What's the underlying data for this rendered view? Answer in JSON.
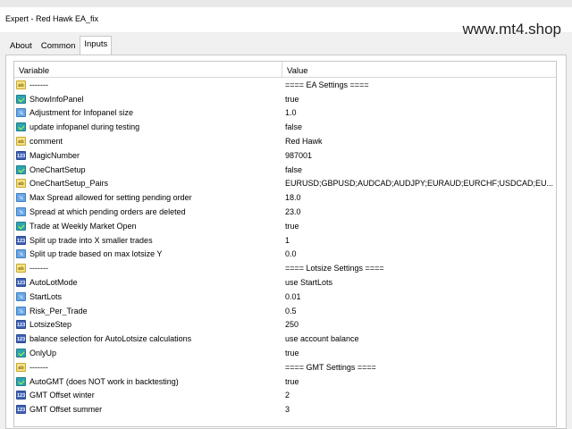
{
  "window": {
    "title": "Expert - Red Hawk EA_fix",
    "watermark": "www.mt4.shop"
  },
  "tabs": [
    {
      "label": "About",
      "active": false
    },
    {
      "label": "Common",
      "active": false
    },
    {
      "label": "Inputs",
      "active": true
    }
  ],
  "table": {
    "headers": [
      "Variable",
      "Value"
    ],
    "rows": [
      {
        "icon": "ab",
        "variable": "-------",
        "value": "==== EA Settings ===="
      },
      {
        "icon": "bool",
        "variable": "ShowInfoPanel",
        "value": "true"
      },
      {
        "icon": "dbl",
        "variable": "Adjustment for Infopanel size",
        "value": "1.0"
      },
      {
        "icon": "bool",
        "variable": "update infopanel during testing",
        "value": "false"
      },
      {
        "icon": "ab",
        "variable": "comment",
        "value": "Red Hawk"
      },
      {
        "icon": "int",
        "variable": "MagicNumber",
        "value": "987001"
      },
      {
        "icon": "bool",
        "variable": "OneChartSetup",
        "value": "false"
      },
      {
        "icon": "ab",
        "variable": "OneChartSetup_Pairs",
        "value": "EURUSD;GBPUSD;AUDCAD;AUDJPY;EURAUD;EURCHF;USDCAD;EU..."
      },
      {
        "icon": "dbl",
        "variable": "Max Spread allowed for setting pending order",
        "value": "18.0"
      },
      {
        "icon": "dbl",
        "variable": "Spread at which pending orders are deleted",
        "value": "23.0"
      },
      {
        "icon": "bool",
        "variable": "Trade at Weekly Market Open",
        "value": "true"
      },
      {
        "icon": "int",
        "variable": "Split up trade into X smaller trades",
        "value": "1"
      },
      {
        "icon": "dbl",
        "variable": "Split up trade based on max lotsize Y",
        "value": "0.0"
      },
      {
        "icon": "ab",
        "variable": "-------",
        "value": "==== Lotsize Settings ===="
      },
      {
        "icon": "int",
        "variable": "AutoLotMode",
        "value": "use StartLots"
      },
      {
        "icon": "dbl",
        "variable": "StartLots",
        "value": "0.01"
      },
      {
        "icon": "dbl",
        "variable": "Risk_Per_Trade",
        "value": "0.5"
      },
      {
        "icon": "int",
        "variable": "LotsizeStep",
        "value": "250"
      },
      {
        "icon": "int",
        "variable": "balance selection for AutoLotsize calculations",
        "value": "use account balance"
      },
      {
        "icon": "bool",
        "variable": "OnlyUp",
        "value": "true"
      },
      {
        "icon": "ab",
        "variable": "-------",
        "value": "==== GMT Settings ===="
      },
      {
        "icon": "bool",
        "variable": "AutoGMT (does NOT work in backtesting)",
        "value": "true"
      },
      {
        "icon": "int",
        "variable": "GMT Offset winter",
        "value": "2"
      },
      {
        "icon": "int",
        "variable": "GMT Offset summer",
        "value": "3"
      }
    ]
  }
}
